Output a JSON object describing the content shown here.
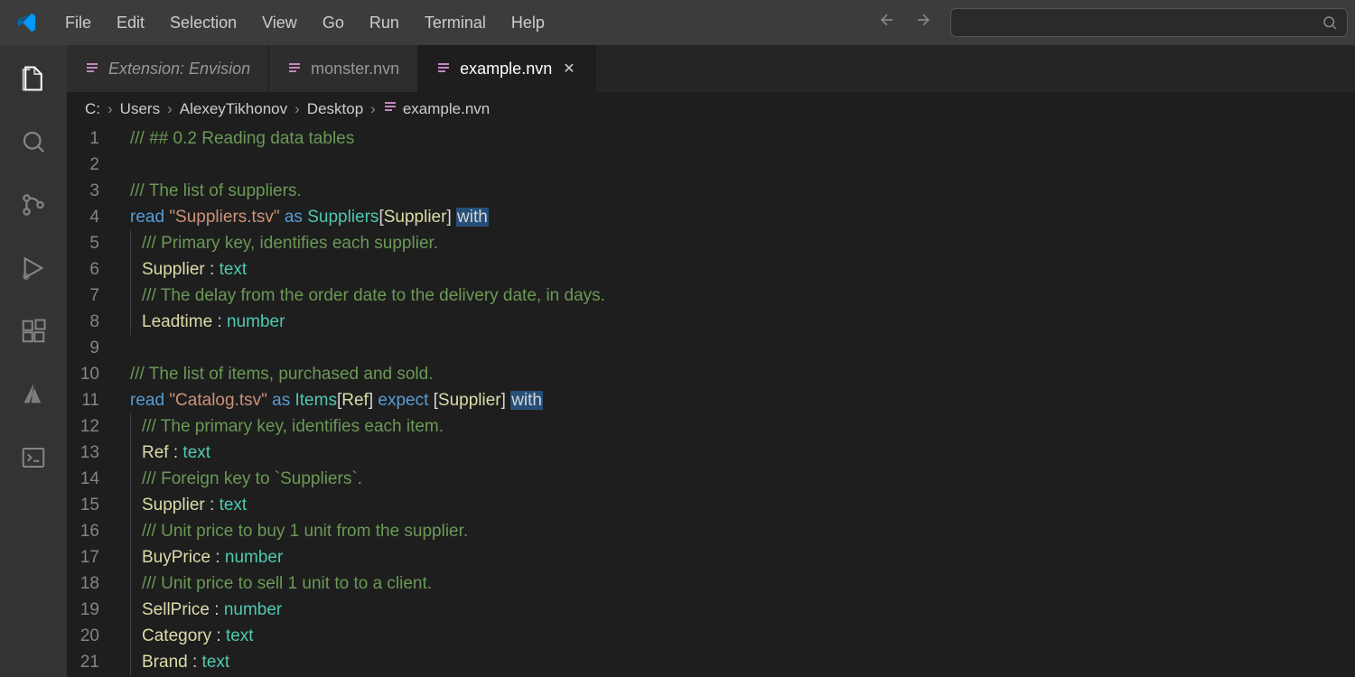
{
  "menu": [
    "File",
    "Edit",
    "Selection",
    "View",
    "Go",
    "Run",
    "Terminal",
    "Help"
  ],
  "tabs": [
    {
      "label": "Extension: Envision",
      "active": false,
      "italic": true,
      "closable": false
    },
    {
      "label": "monster.nvn",
      "active": false,
      "italic": false,
      "closable": false
    },
    {
      "label": "example.nvn",
      "active": true,
      "italic": false,
      "closable": true
    }
  ],
  "breadcrumb": [
    "C:",
    "Users",
    "AlexeyTikhonov",
    "Desktop",
    "example.nvn"
  ],
  "code": [
    {
      "n": 1,
      "t": [
        {
          "c": "c-comment",
          "s": "/// ## 0.2 Reading data tables"
        }
      ]
    },
    {
      "n": 2,
      "t": []
    },
    {
      "n": 3,
      "t": [
        {
          "c": "c-comment",
          "s": "/// The list of suppliers."
        }
      ]
    },
    {
      "n": 4,
      "t": [
        {
          "c": "c-keyword",
          "s": "read "
        },
        {
          "c": "c-string",
          "s": "\"Suppliers.tsv\""
        },
        {
          "c": "c-text",
          "s": " "
        },
        {
          "c": "c-keyword",
          "s": "as"
        },
        {
          "c": "c-text",
          "s": " "
        },
        {
          "c": "c-type",
          "s": "Suppliers"
        },
        {
          "c": "c-text",
          "s": "["
        },
        {
          "c": "c-var",
          "s": "Supplier"
        },
        {
          "c": "c-text",
          "s": "] "
        },
        {
          "c": "c-with-hl",
          "s": "with"
        }
      ]
    },
    {
      "n": 5,
      "indent": true,
      "t": [
        {
          "c": "c-comment",
          "s": "/// Primary key, identifies each supplier."
        }
      ]
    },
    {
      "n": 6,
      "indent": true,
      "t": [
        {
          "c": "c-var",
          "s": "Supplier"
        },
        {
          "c": "c-text",
          "s": " : "
        },
        {
          "c": "c-type",
          "s": "text"
        }
      ]
    },
    {
      "n": 7,
      "indent": true,
      "t": [
        {
          "c": "c-comment",
          "s": "/// The delay from the order date to the delivery date, in days."
        }
      ]
    },
    {
      "n": 8,
      "indent": true,
      "t": [
        {
          "c": "c-var",
          "s": "Leadtime"
        },
        {
          "c": "c-text",
          "s": " : "
        },
        {
          "c": "c-type",
          "s": "number"
        }
      ]
    },
    {
      "n": 9,
      "t": []
    },
    {
      "n": 10,
      "t": [
        {
          "c": "c-comment",
          "s": "/// The list of items, purchased and sold."
        }
      ]
    },
    {
      "n": 11,
      "t": [
        {
          "c": "c-keyword",
          "s": "read "
        },
        {
          "c": "c-string",
          "s": "\"Catalog.tsv\""
        },
        {
          "c": "c-text",
          "s": " "
        },
        {
          "c": "c-keyword",
          "s": "as"
        },
        {
          "c": "c-text",
          "s": " "
        },
        {
          "c": "c-type",
          "s": "Items"
        },
        {
          "c": "c-text",
          "s": "["
        },
        {
          "c": "c-var",
          "s": "Ref"
        },
        {
          "c": "c-text",
          "s": "] "
        },
        {
          "c": "c-keyword",
          "s": "expect"
        },
        {
          "c": "c-text",
          "s": " ["
        },
        {
          "c": "c-var",
          "s": "Supplier"
        },
        {
          "c": "c-text",
          "s": "] "
        },
        {
          "c": "c-with-hl",
          "s": "with"
        }
      ]
    },
    {
      "n": 12,
      "indent": true,
      "t": [
        {
          "c": "c-comment",
          "s": "/// The primary key, identifies each item."
        }
      ]
    },
    {
      "n": 13,
      "indent": true,
      "t": [
        {
          "c": "c-var",
          "s": "Ref"
        },
        {
          "c": "c-text",
          "s": " : "
        },
        {
          "c": "c-type",
          "s": "text"
        }
      ]
    },
    {
      "n": 14,
      "indent": true,
      "t": [
        {
          "c": "c-comment",
          "s": "/// Foreign key to `Suppliers`."
        }
      ]
    },
    {
      "n": 15,
      "indent": true,
      "t": [
        {
          "c": "c-var",
          "s": "Supplier"
        },
        {
          "c": "c-text",
          "s": " : "
        },
        {
          "c": "c-type",
          "s": "text"
        }
      ]
    },
    {
      "n": 16,
      "indent": true,
      "t": [
        {
          "c": "c-comment",
          "s": "/// Unit price to buy 1 unit from the supplier."
        }
      ]
    },
    {
      "n": 17,
      "indent": true,
      "t": [
        {
          "c": "c-var",
          "s": "BuyPrice"
        },
        {
          "c": "c-text",
          "s": " : "
        },
        {
          "c": "c-type",
          "s": "number"
        }
      ]
    },
    {
      "n": 18,
      "indent": true,
      "t": [
        {
          "c": "c-comment",
          "s": "/// Unit price to sell 1 unit to to a client."
        }
      ]
    },
    {
      "n": 19,
      "indent": true,
      "t": [
        {
          "c": "c-var",
          "s": "SellPrice"
        },
        {
          "c": "c-text",
          "s": " : "
        },
        {
          "c": "c-type",
          "s": "number"
        }
      ]
    },
    {
      "n": 20,
      "indent": true,
      "t": [
        {
          "c": "c-var",
          "s": "Category"
        },
        {
          "c": "c-text",
          "s": " : "
        },
        {
          "c": "c-type",
          "s": "text"
        }
      ]
    },
    {
      "n": 21,
      "indent": true,
      "t": [
        {
          "c": "c-var",
          "s": "Brand"
        },
        {
          "c": "c-text",
          "s": " : "
        },
        {
          "c": "c-type",
          "s": "text"
        }
      ]
    }
  ],
  "activity_icons": [
    "files",
    "search",
    "source-control",
    "run-debug",
    "extensions",
    "azure",
    "terminal-panel"
  ]
}
